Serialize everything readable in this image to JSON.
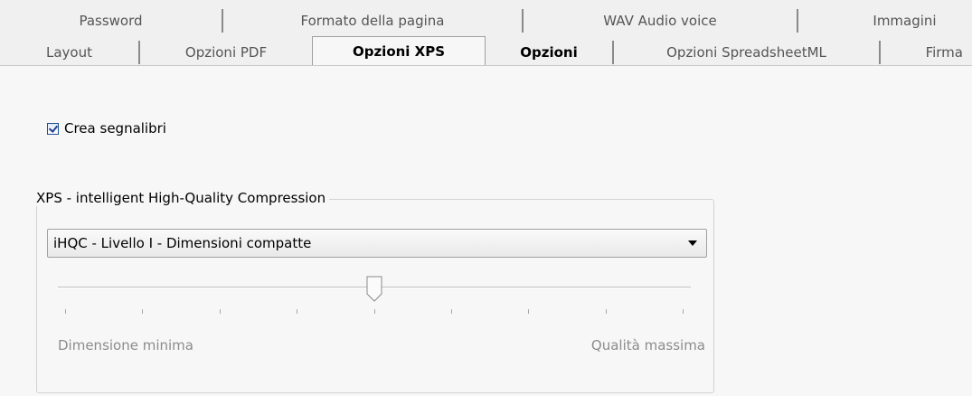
{
  "tabs_row1": [
    {
      "label": "Password"
    },
    {
      "label": "Formato della pagina"
    },
    {
      "label": "WAV Audio voice"
    },
    {
      "label": "Immagini"
    }
  ],
  "tabs_row2": [
    {
      "label": "Layout"
    },
    {
      "label": "Opzioni PDF"
    },
    {
      "label": "Opzioni XPS"
    },
    {
      "label": "Opzioni"
    },
    {
      "label": "Opzioni SpreadsheetML"
    },
    {
      "label": "Firma"
    }
  ],
  "active_tab": "Opzioni XPS",
  "options": {
    "bookmarks_label": "Crea segnalibri",
    "bookmarks_checked": true
  },
  "compression": {
    "group_title": "XPS - intelligent High-Quality Compression",
    "selected_level": "iHQC - Livello I - Dimensioni compatte",
    "slider_position": 0.5,
    "slider_steps": 9,
    "min_label": "Dimensione minima",
    "max_label": "Qualità massima"
  },
  "colors": {
    "background": "#f0f0f0",
    "page": "#f7f7f7",
    "disabled_text": "#8c8c8c",
    "checkbox_accent": "#1e3f8a"
  }
}
